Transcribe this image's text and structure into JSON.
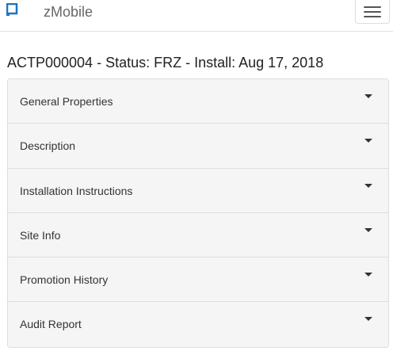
{
  "navbar": {
    "brand": "zMobile",
    "logo_icon": "square-logo-icon",
    "logo_color": "#1a73c8",
    "menu_icon": "hamburger-menu-icon"
  },
  "page": {
    "title": "ACTP000004 - Status: FRZ - Install: Aug 17, 2018"
  },
  "accordion": {
    "panels": [
      {
        "label": "General Properties",
        "icon": "caret-down-icon"
      },
      {
        "label": "Description",
        "icon": "caret-down-icon"
      },
      {
        "label": "Installation Instructions",
        "icon": "caret-down-icon"
      },
      {
        "label": "Site Info",
        "icon": "caret-down-icon"
      },
      {
        "label": "Promotion History",
        "icon": "caret-down-icon"
      },
      {
        "label": "Audit Report",
        "icon": "caret-down-icon"
      }
    ]
  }
}
